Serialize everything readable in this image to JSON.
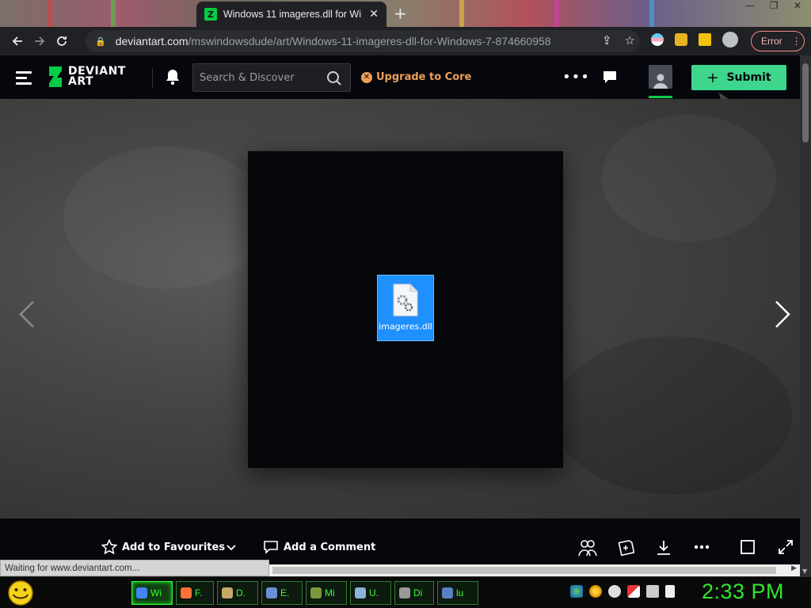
{
  "browser": {
    "tab_title": "Windows 11 imageres.dll for Wi",
    "new_tab_symbol": "+",
    "url_host": "deviantart.com",
    "url_path": "/mswindowsdude/art/Windows-11-imageres-dll-for-Windows-7-874660958",
    "error_label": "Error",
    "status_text": "Waiting for www.deviantart.com..."
  },
  "header": {
    "logo_line1": "DEVIANT",
    "logo_line2": "ART",
    "search_placeholder": "Search & Discover",
    "upgrade_label": "Upgrade to Core",
    "more_label": "•••",
    "submit_label": "Submit",
    "submit_plus": "+"
  },
  "artwork": {
    "file_name": "imageres.dll"
  },
  "actions": {
    "favourite_label": "Add to Favourites",
    "comment_label": "Add a Comment"
  },
  "taskbar": {
    "buttons": [
      {
        "label": "Wi",
        "color": "#4285f4",
        "active": true
      },
      {
        "label": "F.",
        "color": "#ff7139",
        "active": false
      },
      {
        "label": "D.",
        "color": "#c9a96b",
        "active": false
      },
      {
        "label": "E.",
        "color": "#6b8fd6",
        "active": false
      },
      {
        "label": "Mi",
        "color": "#7a9a3a",
        "active": false
      },
      {
        "label": "U.",
        "color": "#8ab4d8",
        "active": false
      },
      {
        "label": "Di",
        "color": "#999999",
        "active": false
      },
      {
        "label": "lu",
        "color": "#5a7fc4",
        "active": false
      }
    ],
    "clock": "2:33 PM"
  },
  "colors": {
    "da_green": "#05cc47",
    "submit_green": "#3dd68c",
    "upgrade_orange": "#ee9f57",
    "clock_green": "#2ee82e",
    "file_selection_blue": "#1e90ff"
  }
}
